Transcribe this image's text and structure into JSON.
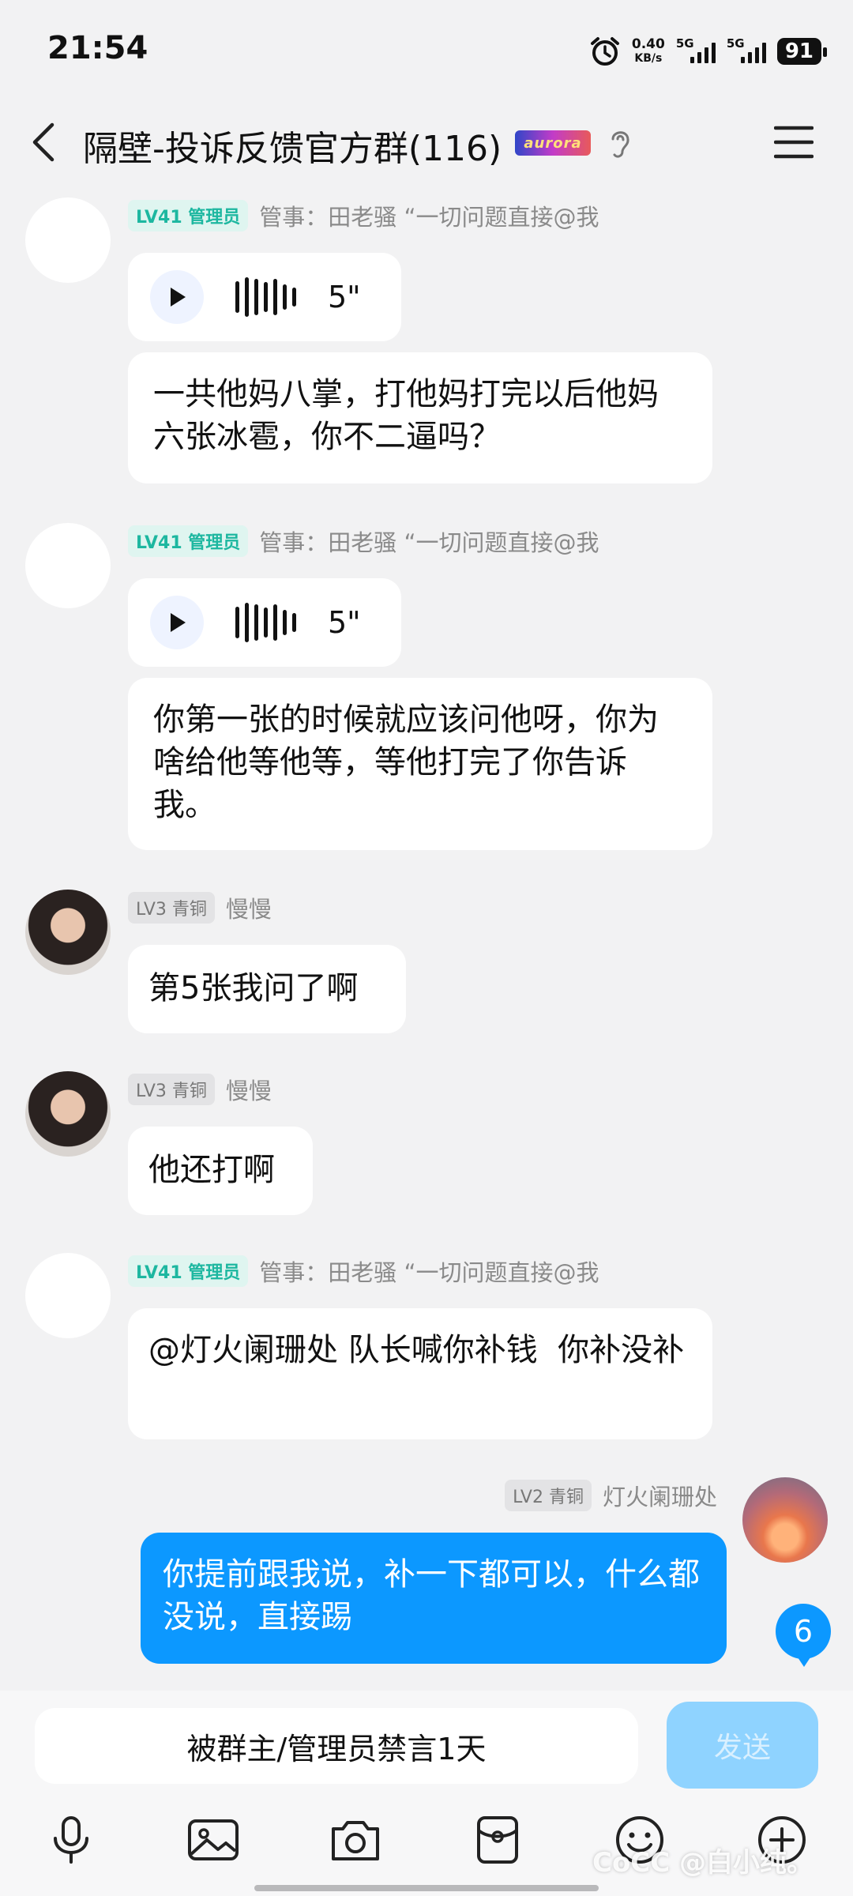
{
  "status": {
    "time": "21:54",
    "net_speed_value": "0.40",
    "net_speed_unit": "KB/s",
    "network1": "5G",
    "network2": "5G",
    "battery": "91"
  },
  "header": {
    "title": "隔壁-投诉反馈官方群(116)",
    "badge": "aurora"
  },
  "messages": [
    {
      "level": "LV41 管理员",
      "sender": "管事：田老骚 “一切问题直接@我",
      "voice_duration": "5\"",
      "text": "一共他妈八掌，打他妈打完以后他妈六张冰雹，你不二逼吗？"
    },
    {
      "level": "LV41 管理员",
      "sender": "管事：田老骚 “一切问题直接@我",
      "voice_duration": "5\"",
      "text": "你第一张的时候就应该问他呀，你为啥给他等他等，等他打完了你告诉我。"
    },
    {
      "level": "LV3 青铜",
      "sender": "慢慢",
      "text": "第5张我问了啊"
    },
    {
      "level": "LV3 青铜",
      "sender": "慢慢",
      "text": "他还打啊"
    },
    {
      "level": "LV41 管理员",
      "sender": "管事：田老骚 “一切问题直接@我",
      "text": "@灯火阑珊处 队长喊你补钱  你补没补"
    },
    {
      "level": "LV2 青铜",
      "sender": "灯火阑珊处",
      "text": "你提前跟我说，补一下都可以，什么都没说，直接踢"
    }
  ],
  "unread_count": "6",
  "input": {
    "muted_text": "被群主/管理员禁言1天",
    "send_label": "发送"
  },
  "toolbar": [
    "mic-icon",
    "image-icon",
    "camera-icon",
    "red-packet-icon",
    "emoji-icon",
    "plus-icon"
  ],
  "watermark": "CoCC @白小纯。"
}
